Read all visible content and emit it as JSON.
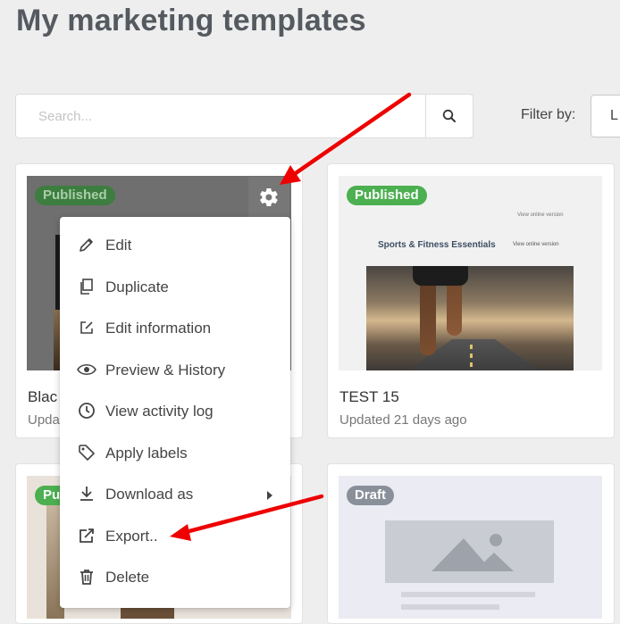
{
  "page": {
    "title": "My marketing templates"
  },
  "search": {
    "placeholder": "Search..."
  },
  "filter": {
    "label": "Filter by:",
    "selected": "L"
  },
  "cards": [
    {
      "badge": "Published",
      "title": "Blac",
      "updated": "Upda"
    },
    {
      "badge": "Published",
      "title": "TEST 15",
      "updated": "Updated 21 days ago",
      "preview": {
        "heading": "Sports & Fitness Essentials",
        "view_online_1": "View online version",
        "view_online_2": "View online version"
      }
    },
    {
      "badge": "Pu"
    },
    {
      "badge": "Draft"
    }
  ],
  "menu": {
    "items": [
      {
        "label": "Edit",
        "icon": "pencil-icon"
      },
      {
        "label": "Duplicate",
        "icon": "duplicate-icon"
      },
      {
        "label": "Edit information",
        "icon": "edit-info-icon"
      },
      {
        "label": "Preview & History",
        "icon": "eye-icon"
      },
      {
        "label": "View activity log",
        "icon": "clock-icon"
      },
      {
        "label": "Apply labels",
        "icon": "tag-icon"
      },
      {
        "label": "Download as",
        "icon": "download-icon",
        "has_submenu": true
      },
      {
        "label": "Export..",
        "icon": "export-icon"
      },
      {
        "label": "Delete",
        "icon": "trash-icon"
      }
    ]
  },
  "colors": {
    "published": "#4caf50",
    "draft": "#8a9099",
    "annotation_arrow": "#ee0000"
  }
}
